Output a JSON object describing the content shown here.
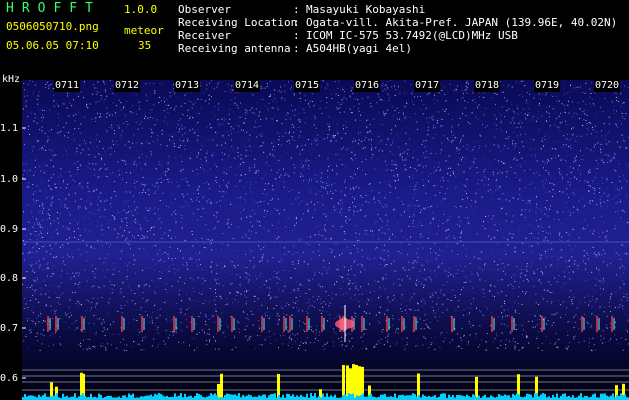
{
  "app": {
    "name": "HROFFT",
    "version": "1.0.0",
    "file_name": "0506050710.png",
    "datetime": "05.06.05 07:10",
    "meteor_label": "meteor",
    "meteor_count": "35"
  },
  "info": [
    {
      "key": "Observer",
      "sep": ":",
      "value": "Masayuki Kobayashi"
    },
    {
      "key": "Receiving Location",
      "sep": ":",
      "value": "Ogata-vill. Akita-Pref. JAPAN (139.96E, 40.02N)"
    },
    {
      "key": "Receiver",
      "sep": ":",
      "value": "ICOM IC-575 53.7492(@LCD)MHz USB"
    },
    {
      "key": "Receiving antenna",
      "sep": ":",
      "value": "A504HB(yagi 4el)"
    }
  ],
  "axis": {
    "unit": "kHz",
    "freq_ticks": [
      "1.1",
      "1.0",
      "0.9",
      "0.8",
      "0.7",
      "0.6"
    ],
    "time_ticks": [
      "0711",
      "0712",
      "0713",
      "0714",
      "0715",
      "0716",
      "0717",
      "0718",
      "0719",
      "0720"
    ]
  },
  "colors": {
    "background": "#000000",
    "noise_blue": "#2a2aa8",
    "signal_red": "#ff3040",
    "signal_cyan": "#40ffff",
    "bars_yellow": "#ffff00",
    "baseline_cyan": "#00d0ff"
  }
}
